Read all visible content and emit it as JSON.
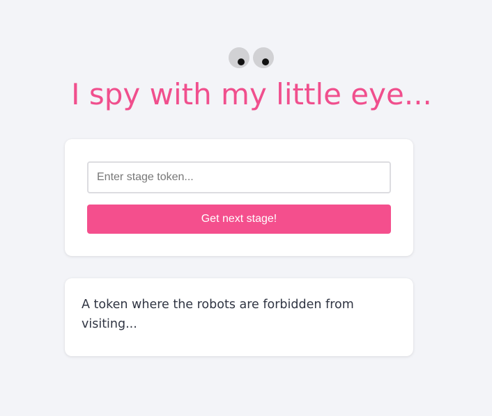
{
  "header": {
    "title": "I spy with my little eye...",
    "accent_color": "#f04f8d"
  },
  "form": {
    "token_placeholder": "Enter stage token...",
    "token_value": "",
    "submit_label": "Get next stage!",
    "button_color": "#f44f8d"
  },
  "hint": {
    "text": "A token where the robots are forbidden from visiting..."
  }
}
